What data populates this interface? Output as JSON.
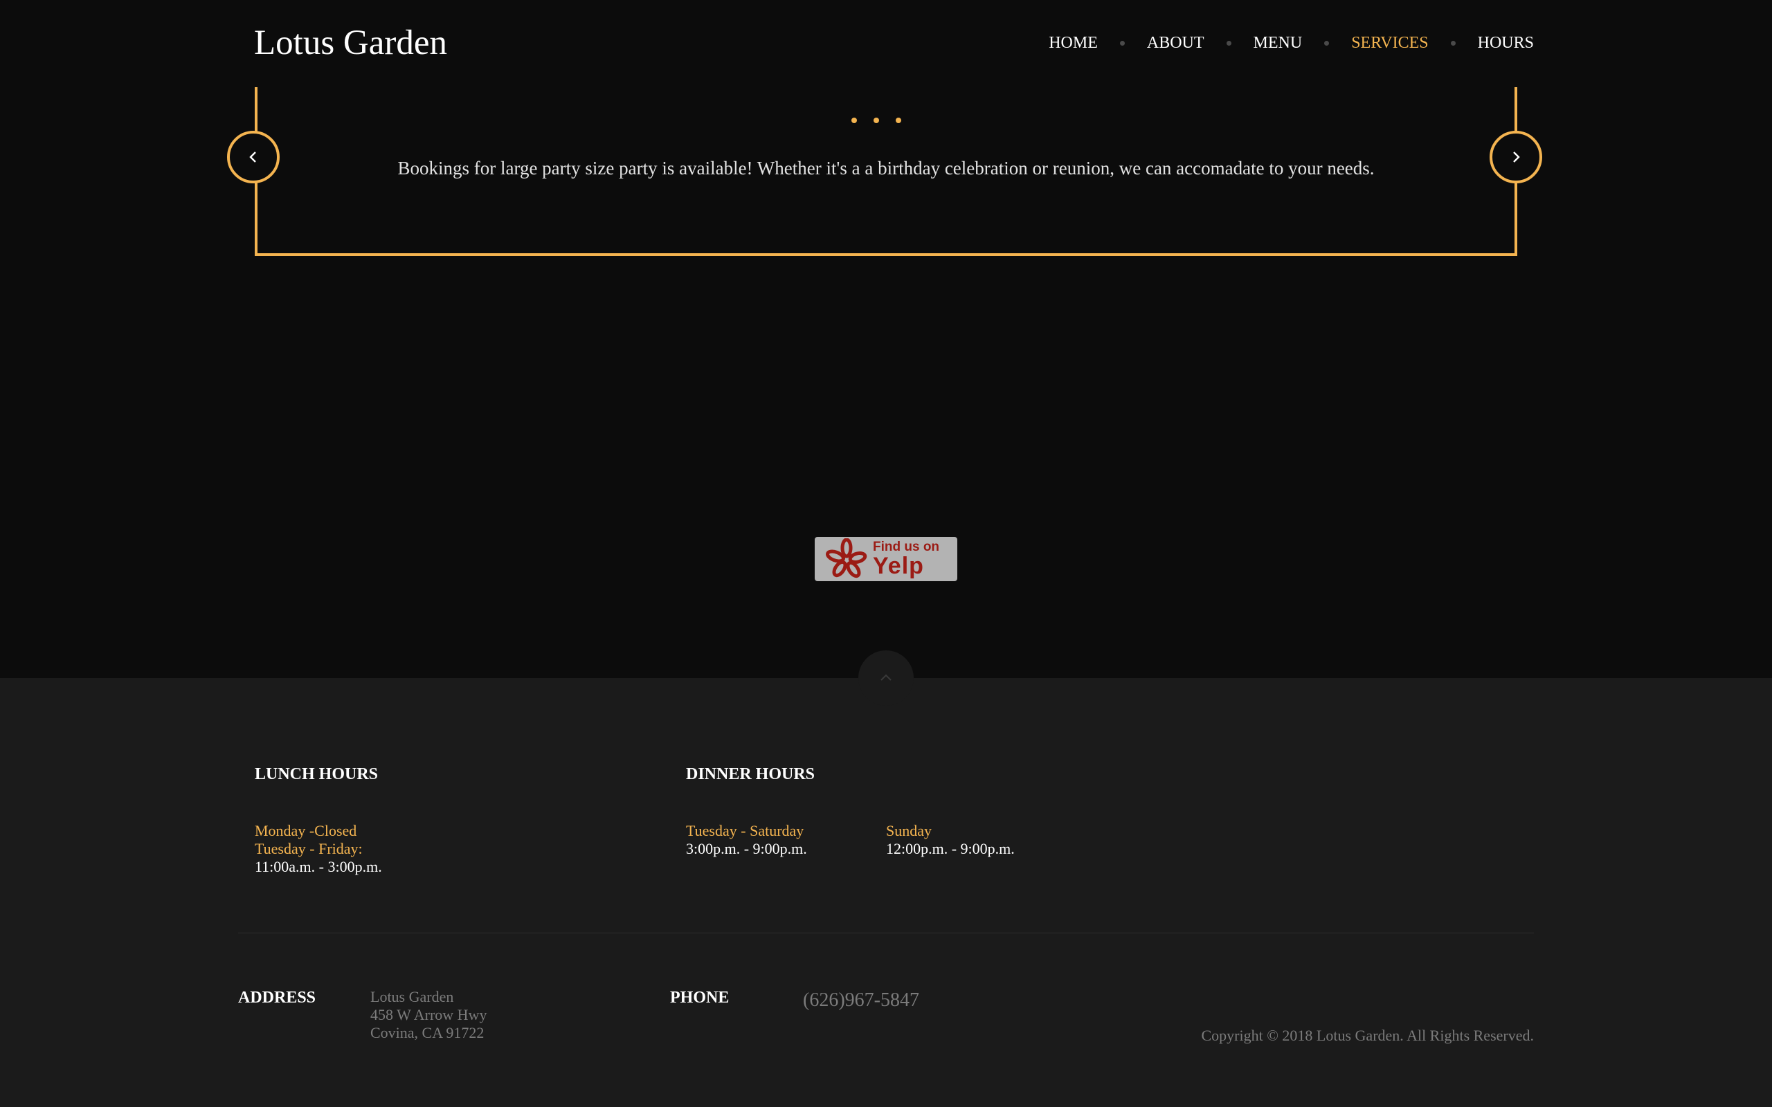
{
  "header": {
    "logo": "Lotus Garden",
    "nav": [
      {
        "label": "HOME",
        "active": false
      },
      {
        "label": "ABOUT",
        "active": false
      },
      {
        "label": "MENU",
        "active": false
      },
      {
        "label": "SERVICES",
        "active": true
      },
      {
        "label": "HOURS",
        "active": false
      }
    ]
  },
  "slider": {
    "text": "Bookings for large party size party is available! Whether it's a a birthday celebration or reunion, we can accomadate to your needs.",
    "dot_count": 3,
    "prev_icon": "chevron-left-icon",
    "next_icon": "chevron-right-icon"
  },
  "yelp": {
    "line1": "Find us on",
    "line2": "Yelp",
    "icon": "yelp-burst-icon"
  },
  "footer": {
    "lunch": {
      "title": "LUNCH HOURS",
      "line1": "Monday -Closed",
      "line2": "Tuesday - Friday:",
      "line3": "11:00a.m. - 3:00p.m."
    },
    "dinner": {
      "title": "DINNER HOURS",
      "weekday_label": "Tuesday - Saturday",
      "weekday_time": "3:00p.m. - 9:00p.m.",
      "sunday_label": "Sunday",
      "sunday_time": "12:00p.m. - 9:00p.m."
    },
    "address": {
      "label": "ADDRESS",
      "line1": "Lotus Garden",
      "line2": "458 W Arrow Hwy",
      "line3": "Covina, CA 91722"
    },
    "phone": {
      "label": "PHONE",
      "number": "(626)967-5847"
    },
    "copyright": "Copyright © 2018 Lotus Garden. All Rights Reserved.",
    "to_top_icon": "chevron-up-icon"
  },
  "colors": {
    "background": "#0c0c0c",
    "footer_background": "#1b1b1b",
    "accent": "#f4b450",
    "muted_text": "#7b7b7b"
  }
}
